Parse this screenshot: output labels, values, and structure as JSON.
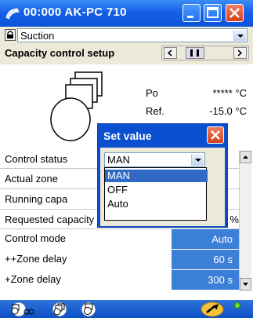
{
  "window": {
    "title": "00:000 AK-PC 710",
    "colors": {
      "titlebar": "#1660e8",
      "close": "#d63f1c",
      "value_cell": "#3b7fd8",
      "selection": "#316ac5"
    }
  },
  "group_select": {
    "value": "Suction"
  },
  "section": {
    "title": "Capacity control setup"
  },
  "readouts": [
    {
      "label": "Po",
      "value": "***** °C"
    },
    {
      "label": "Ref.",
      "value": "-15.0 °C"
    }
  ],
  "rows": [
    {
      "label": "Control status",
      "value": ""
    },
    {
      "label": "Actual zone",
      "value": ""
    },
    {
      "label": "Running capa",
      "value": ""
    },
    {
      "label": "Requested capacity",
      "value": "50 %"
    },
    {
      "label": "Control mode",
      "value": "Auto"
    },
    {
      "label": "++Zone delay",
      "value": "60 s"
    },
    {
      "label": "+Zone delay",
      "value": "300 s"
    }
  ],
  "dialog": {
    "title": "Set value",
    "selected": "MAN",
    "options": [
      "MAN",
      "OFF",
      "Auto"
    ],
    "highlighted_index": 0
  },
  "bottom_icons": [
    "compressor-group-icon",
    "compressors-icon",
    "compressor-icon",
    "wrench-icon",
    "status-led-icon"
  ]
}
